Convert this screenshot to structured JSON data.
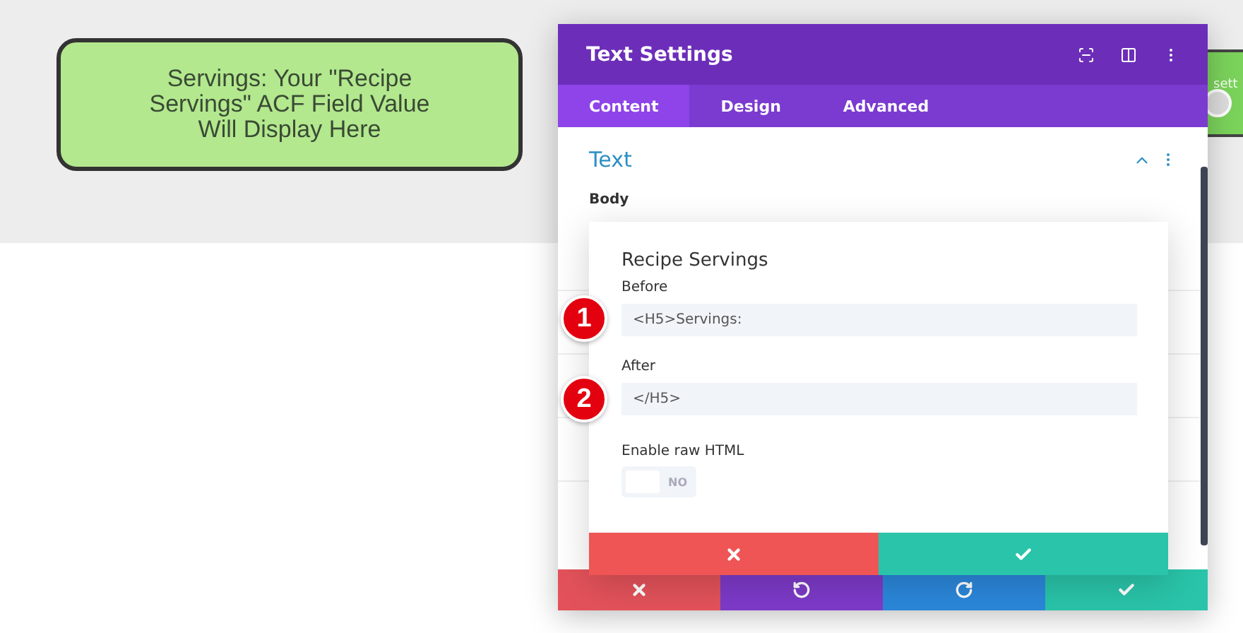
{
  "preview_card": {
    "text": "Servings: Your \"Recipe Servings\" ACF Field Value Will Display Here"
  },
  "behind_snippet": {
    "text": "sett"
  },
  "panel": {
    "title": "Text Settings",
    "tabs": [
      {
        "label": "Content",
        "selected": true
      },
      {
        "label": "Design",
        "selected": false
      },
      {
        "label": "Advanced",
        "selected": false
      }
    ],
    "section": {
      "title": "Text",
      "expanded": true,
      "field_label": "Body"
    }
  },
  "popup": {
    "title": "Recipe Servings",
    "fields": [
      {
        "label": "Before",
        "value": "<H5>Servings:",
        "badge": "1"
      },
      {
        "label": "After",
        "value": "</H5>",
        "badge": "2"
      }
    ],
    "toggle": {
      "label": "Enable raw HTML",
      "on": false,
      "state_text": "NO"
    }
  }
}
